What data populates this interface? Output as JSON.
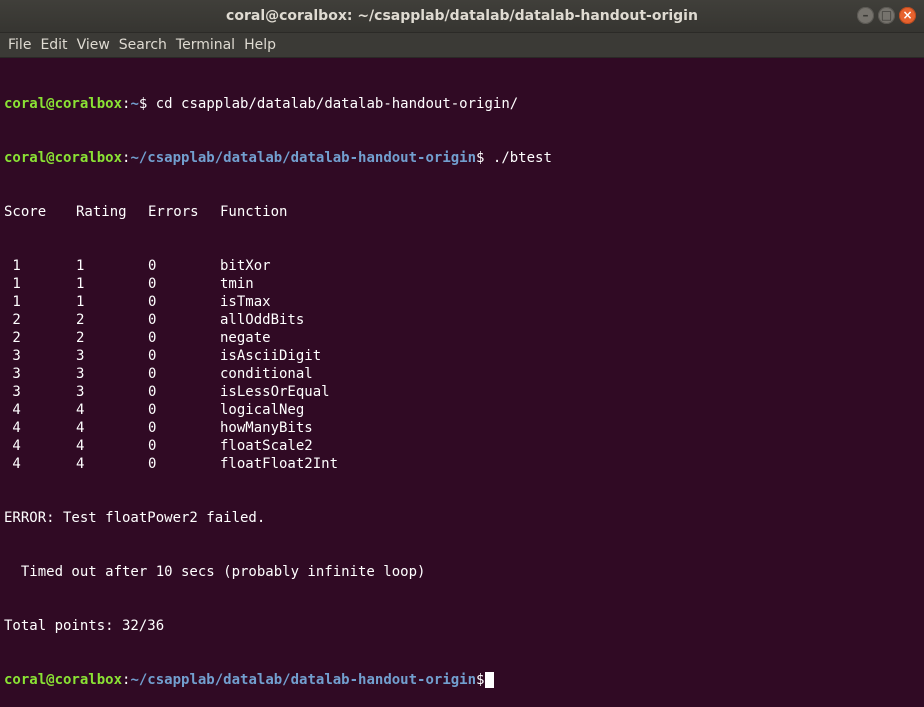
{
  "window": {
    "title": "coral@coralbox: ~/csapplab/datalab/datalab-handout-origin",
    "buttons": {
      "minimize": "–",
      "maximize": "□",
      "close": "×"
    }
  },
  "menu": [
    "File",
    "Edit",
    "View",
    "Search",
    "Terminal",
    "Help"
  ],
  "terminal": {
    "prompt1": {
      "user": "coral@coralbox",
      "sep": ":",
      "path": "~",
      "sign": "$ ",
      "command": "cd csapplab/datalab/datalab-handout-origin/"
    },
    "prompt2": {
      "user": "coral@coralbox",
      "sep": ":",
      "path": "~/csapplab/datalab/datalab-handout-origin",
      "sign": "$ ",
      "command": "./btest"
    },
    "header": {
      "score": "Score",
      "rating": "Rating",
      "errors": "Errors",
      "function": "Function"
    },
    "rows": [
      {
        "score": " 1",
        "rating": "1",
        "errors": "0",
        "function": "bitXor"
      },
      {
        "score": " 1",
        "rating": "1",
        "errors": "0",
        "function": "tmin"
      },
      {
        "score": " 1",
        "rating": "1",
        "errors": "0",
        "function": "isTmax"
      },
      {
        "score": " 2",
        "rating": "2",
        "errors": "0",
        "function": "allOddBits"
      },
      {
        "score": " 2",
        "rating": "2",
        "errors": "0",
        "function": "negate"
      },
      {
        "score": " 3",
        "rating": "3",
        "errors": "0",
        "function": "isAsciiDigit"
      },
      {
        "score": " 3",
        "rating": "3",
        "errors": "0",
        "function": "conditional"
      },
      {
        "score": " 3",
        "rating": "3",
        "errors": "0",
        "function": "isLessOrEqual"
      },
      {
        "score": " 4",
        "rating": "4",
        "errors": "0",
        "function": "logicalNeg"
      },
      {
        "score": " 4",
        "rating": "4",
        "errors": "0",
        "function": "howManyBits"
      },
      {
        "score": " 4",
        "rating": "4",
        "errors": "0",
        "function": "floatScale2"
      },
      {
        "score": " 4",
        "rating": "4",
        "errors": "0",
        "function": "floatFloat2Int"
      }
    ],
    "error_line": "ERROR: Test floatPower2 failed.",
    "timeout_line": "  Timed out after 10 secs (probably infinite loop)",
    "total_line": "Total points: 32/36",
    "prompt3": {
      "user": "coral@coralbox",
      "sep": ":",
      "path": "~/csapplab/datalab/datalab-handout-origin",
      "sign": "$"
    }
  },
  "colors": {
    "background": "#300a24",
    "user": "#8ae234",
    "path": "#729fcf",
    "text": "#ffffff"
  }
}
